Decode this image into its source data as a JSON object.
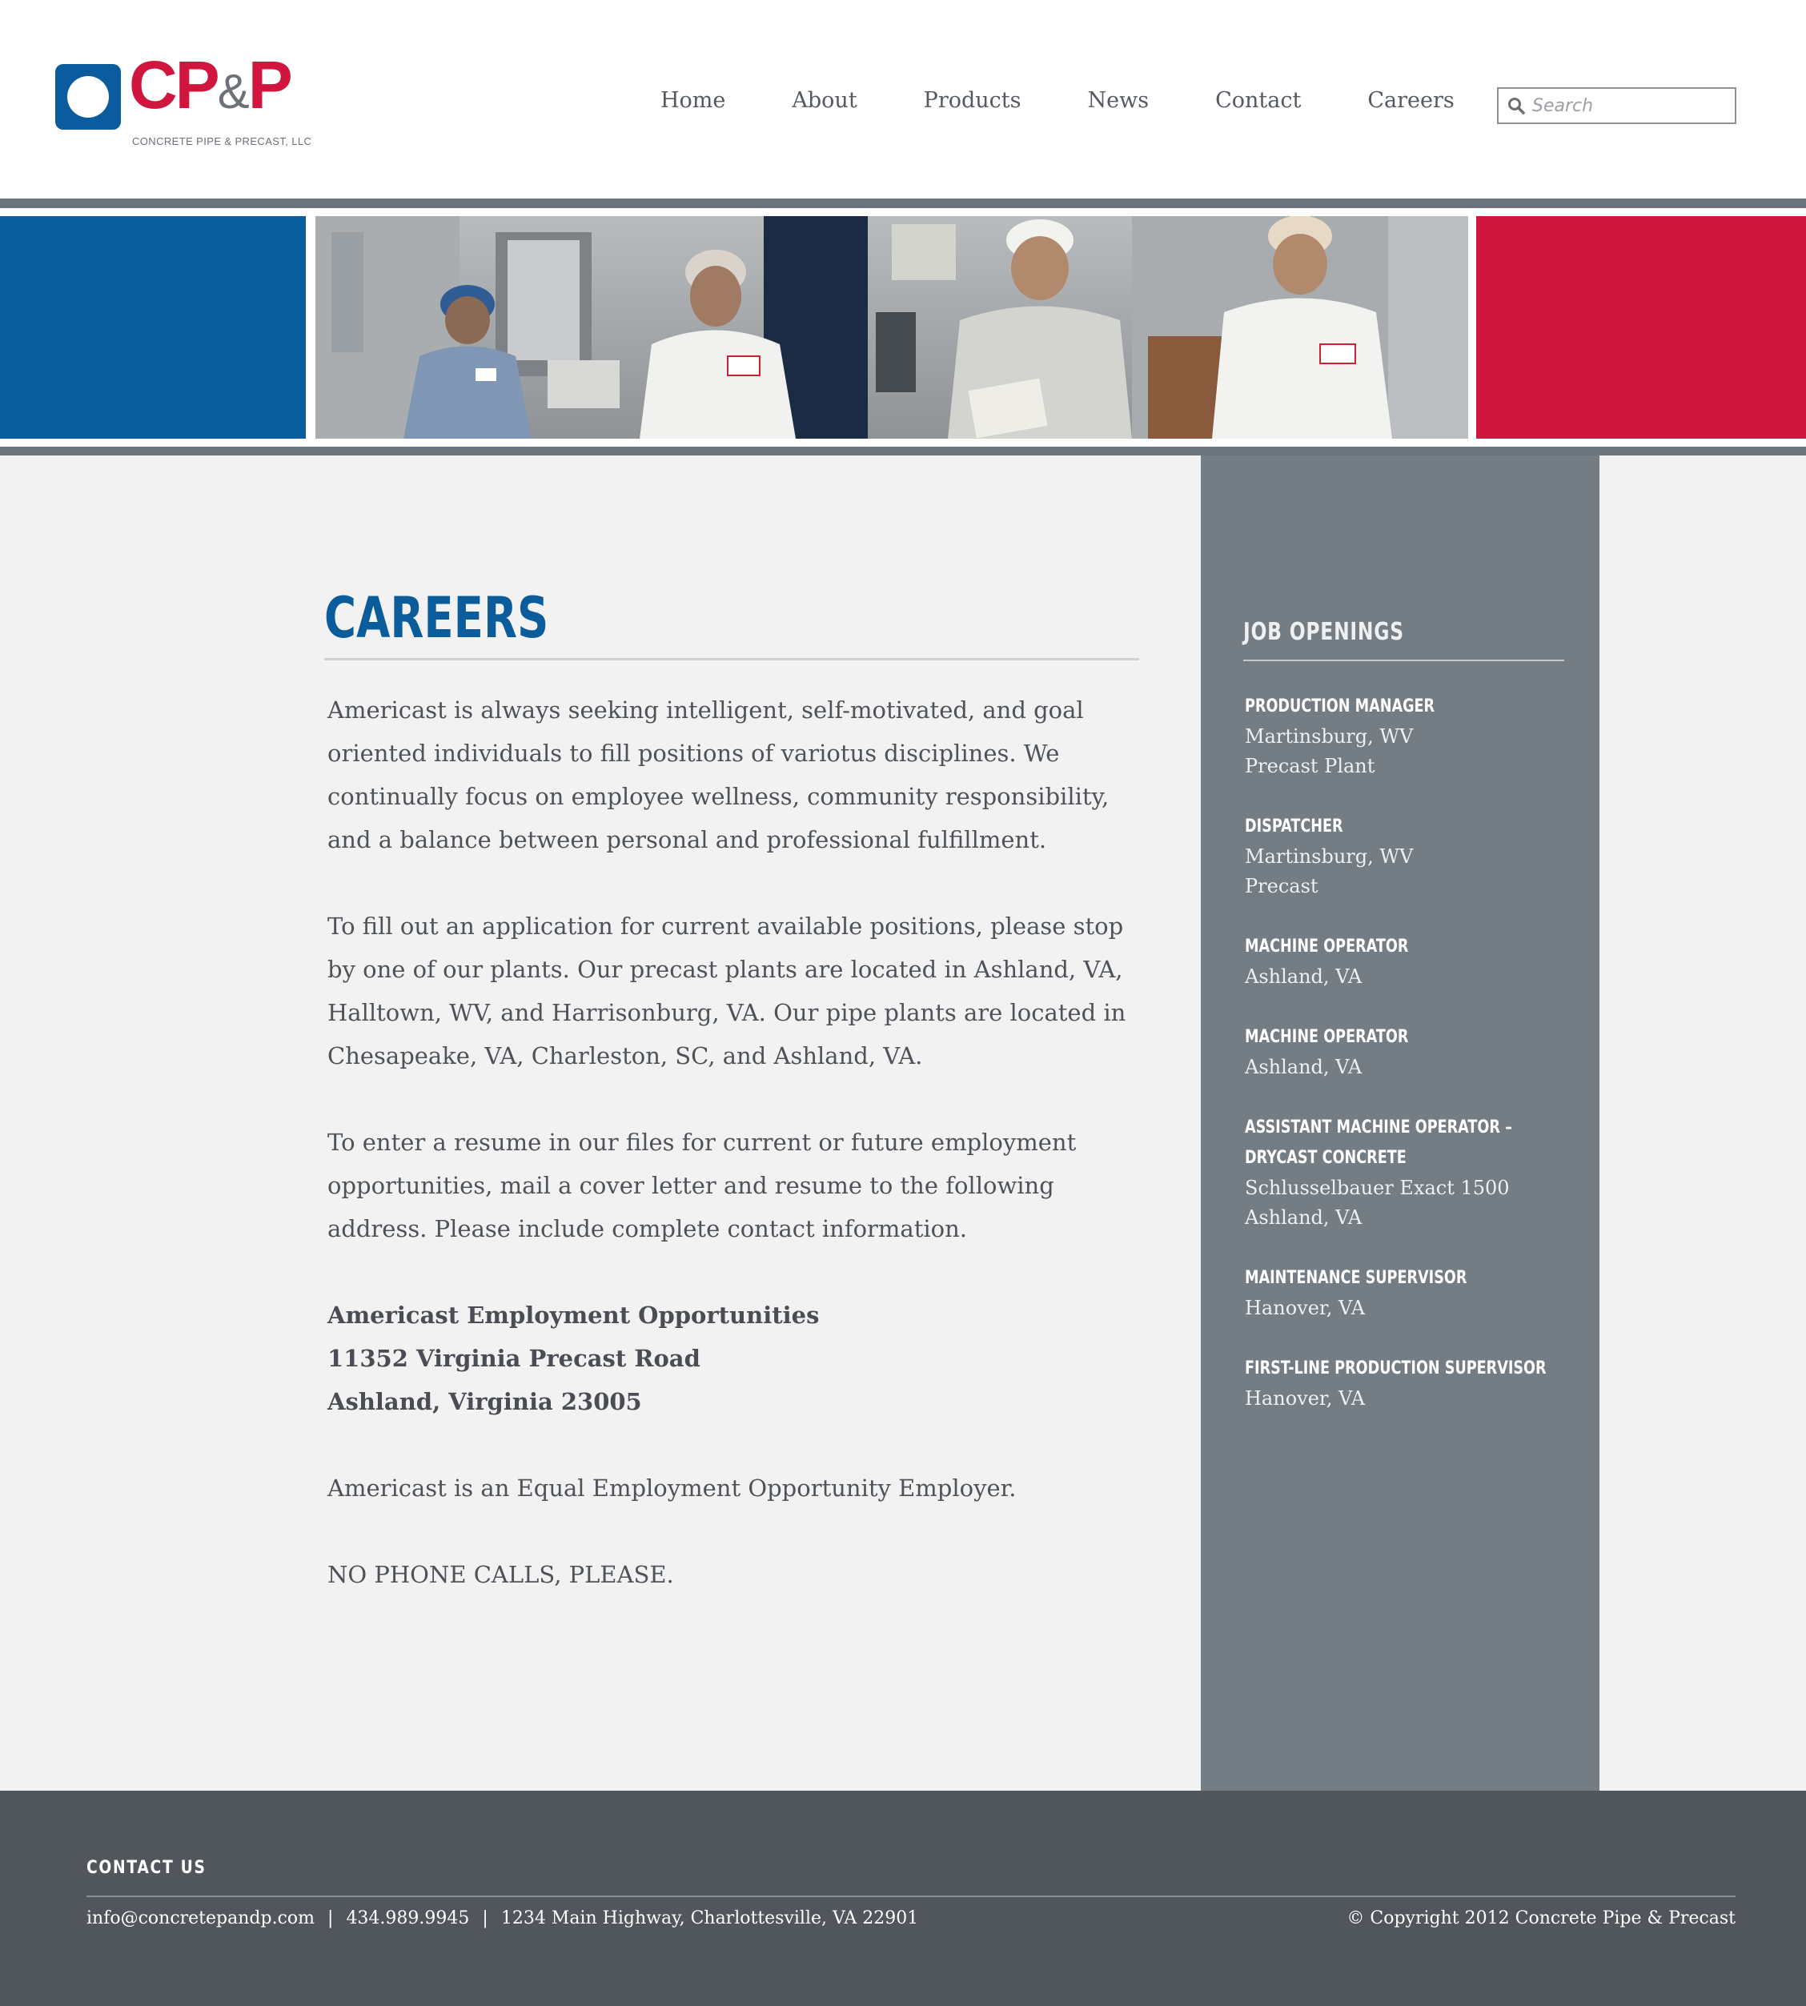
{
  "brand": {
    "logo_text": "CP",
    "logo_amp": "&",
    "logo_text_end": "P",
    "tagline": "CONCRETE PIPE & PRECAST, LLC",
    "blue": "#0b5e9e",
    "red": "#d0153f"
  },
  "nav": {
    "items": [
      {
        "label": "Home"
      },
      {
        "label": "About"
      },
      {
        "label": "Products"
      },
      {
        "label": "News"
      },
      {
        "label": "Contact"
      },
      {
        "label": "Careers"
      }
    ]
  },
  "search": {
    "placeholder": "Search",
    "icon": "search-icon"
  },
  "banner": {
    "icon": "photo-workers-in-plant"
  },
  "main": {
    "title": "CAREERS",
    "paragraphs": [
      "Americast is always seeking intelligent, self-motivated, and goal oriented individuals to fill positions of variotus disciplines. We continually focus on employee wellness, community responsibility, and a balance between personal and professional fulfillment.",
      "To fill out an application for current available positions, please stop by one of our plants. Our precast plants are located in Ashland, VA, Halltown, WV, and Harrisonburg, VA. Our pipe plants are located in Chesapeake, VA, Charleston, SC, and Ashland, VA.",
      "To enter a resume in our files for current or future employment opportunities, mail a cover letter and resume to the following address. Please include complete contact information."
    ],
    "address": {
      "name": "Americast Employment Opportunities",
      "street": "11352 Virginia Precast Road",
      "city": "Ashland, Virginia 23005"
    },
    "eeo": "Americast is an Equal Employment Opportunity Employer.",
    "no_calls": "NO PHONE CALLS, PLEASE."
  },
  "sidebar": {
    "title": "JOB OPENINGS",
    "jobs": [
      {
        "title": "PRODUCTION MANAGER",
        "line1": "Martinsburg, WV",
        "line2": "Precast Plant"
      },
      {
        "title": "DISPATCHER",
        "line1": "Martinsburg, WV",
        "line2": "Precast"
      },
      {
        "title": "MACHINE OPERATOR",
        "line1": "Ashland, VA"
      },
      {
        "title": "MACHINE OPERATOR",
        "line1": "Ashland, VA"
      },
      {
        "title": "ASSISTANT MACHINE OPERATOR – DRYCAST CONCRETE",
        "line1": "Schlusselbauer Exact 1500",
        "line2": "Ashland, VA"
      },
      {
        "title": "MAINTENANCE SUPERVISOR",
        "line1": "Hanover, VA"
      },
      {
        "title": "FIRST-LINE PRODUCTION SUPERVISOR",
        "line1": "Hanover, VA"
      }
    ]
  },
  "footer": {
    "title": "CONTACT US",
    "email": "info@concretepandp.com",
    "sep": "|",
    "phone": "434.989.9945",
    "address": "1234 Main Highway, Charlottesville, VA 22901",
    "copyright": "© Copyright 2012 Concrete Pipe & Precast"
  }
}
